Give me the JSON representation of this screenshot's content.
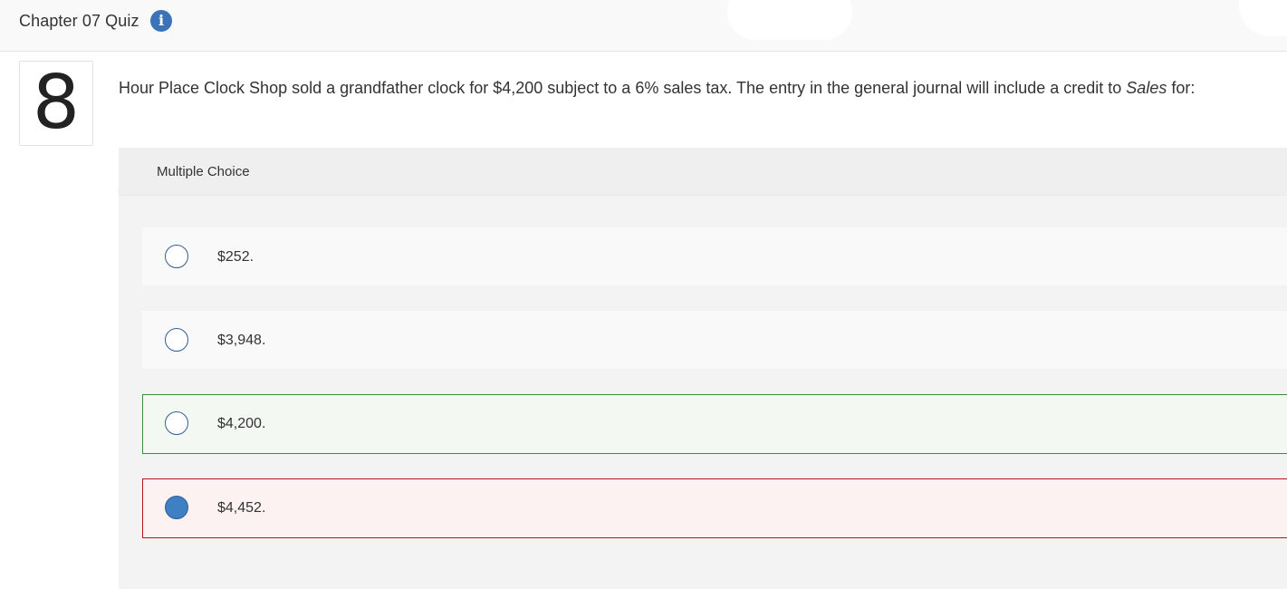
{
  "header": {
    "title": "Chapter 07 Quiz",
    "info_icon": "info-icon"
  },
  "question": {
    "number": "8",
    "text_before": "Hour Place Clock Shop sold a grandfather clock for $4,200 subject to a 6% sales tax. The entry in the general journal will include a credit to ",
    "text_emphasis": "Sales",
    "text_after": " for:"
  },
  "multiple_choice": {
    "label": "Multiple Choice",
    "options": [
      {
        "label": "$252.",
        "selected": false,
        "state": "neutral"
      },
      {
        "label": "$3,948.",
        "selected": false,
        "state": "neutral"
      },
      {
        "label": "$4,200.",
        "selected": false,
        "state": "correct"
      },
      {
        "label": "$4,452.",
        "selected": true,
        "state": "incorrect"
      }
    ]
  },
  "colors": {
    "accent_blue": "#3b72b8",
    "correct_border": "#3d8a3d",
    "incorrect_border": "#b8121f"
  }
}
